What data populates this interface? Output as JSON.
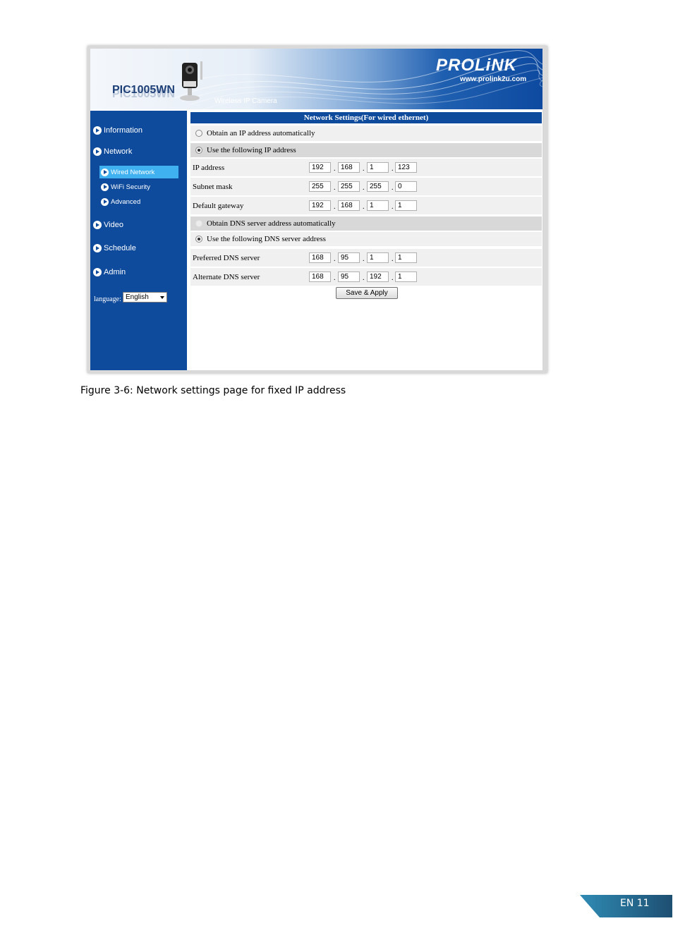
{
  "header": {
    "model": "PIC1005WN",
    "subtitle": "Wireless IP Camera",
    "brand": "PROLiNK",
    "brand_url": "www.prolink2u.com"
  },
  "sidebar": {
    "items": [
      {
        "label": "Information"
      },
      {
        "label": "Network"
      },
      {
        "label": "Video"
      },
      {
        "label": "Schedule"
      },
      {
        "label": "Admin"
      }
    ],
    "sub_items": [
      {
        "label": "Wired Network",
        "active": true
      },
      {
        "label": "WiFi Security"
      },
      {
        "label": "Advanced"
      }
    ],
    "language_label": "language:",
    "language_value": "English"
  },
  "form": {
    "title": "Network Settings(For wired ethernet)",
    "obtain_ip_auto": "Obtain an IP address automatically",
    "use_following_ip": "Use the following IP address",
    "ip_address_label": "IP address",
    "ip_address": [
      "192",
      "168",
      "1",
      "123"
    ],
    "subnet_mask_label": "Subnet mask",
    "subnet_mask": [
      "255",
      "255",
      "255",
      "0"
    ],
    "default_gateway_label": "Default gateway",
    "default_gateway": [
      "192",
      "168",
      "1",
      "1"
    ],
    "obtain_dns_auto": "Obtain DNS server address automatically",
    "use_following_dns": "Use the following DNS server address",
    "preferred_dns_label": "Preferred DNS server",
    "preferred_dns": [
      "168",
      "95",
      "1",
      "1"
    ],
    "alternate_dns_label": "Alternate DNS server",
    "alternate_dns": [
      "168",
      "95",
      "192",
      "1"
    ],
    "save_label": "Save & Apply",
    "dot": "."
  },
  "caption": "Figure 3-6: Network settings page for fixed IP address",
  "page_number": "EN 11",
  "colors": {
    "sidebar": "#0f4b9c",
    "active_item": "#3fb1f0",
    "title_bar": "#0f4b9c"
  }
}
